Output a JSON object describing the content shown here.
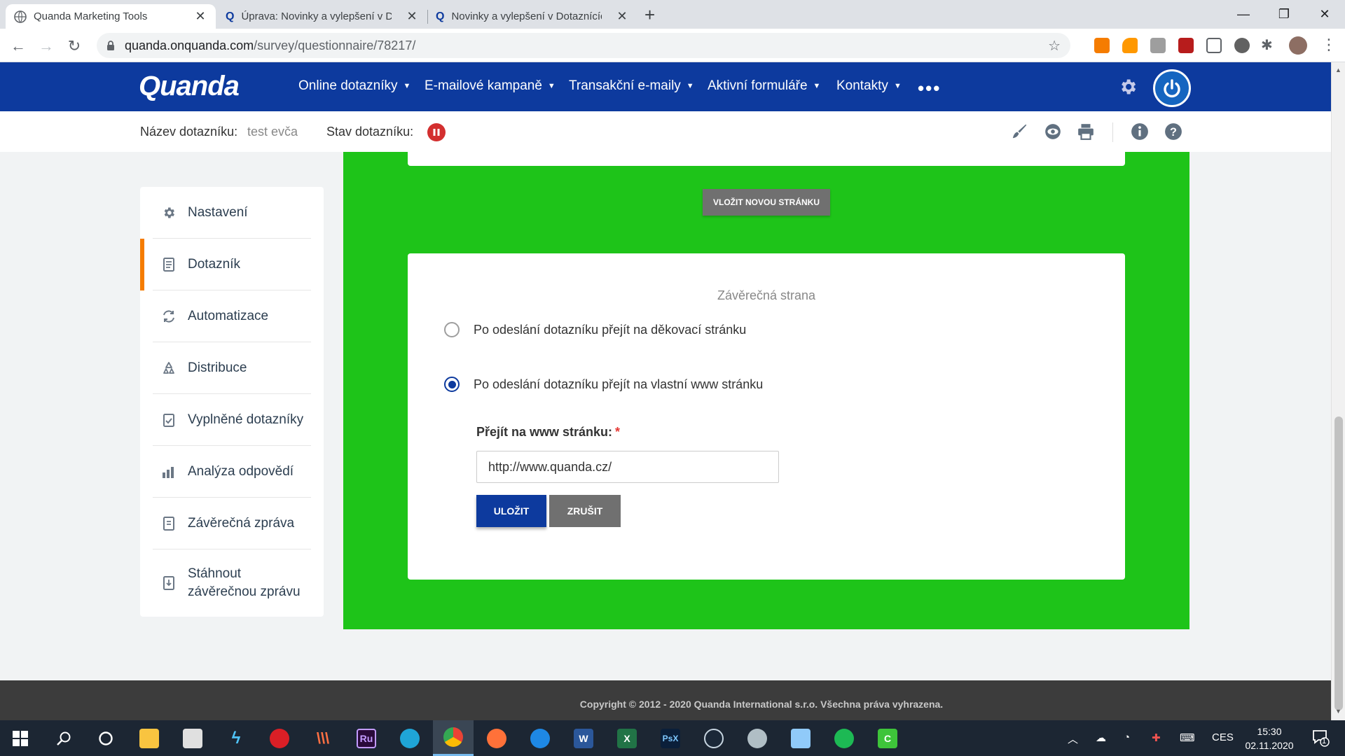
{
  "browser": {
    "tabs": [
      {
        "title": "Quanda Marketing Tools",
        "active": true
      },
      {
        "title": "Úprava: Novinky a vylepšení v Dotaznících",
        "active": false
      },
      {
        "title": "Novinky a vylepšení v Dotaznících",
        "active": false
      }
    ],
    "new_tab": "+",
    "url_host": "quanda.onquanda.com",
    "url_path": "/survey/questionnaire/78217/"
  },
  "app": {
    "logo": "Quanda",
    "menu": [
      {
        "label": "Online dotazníky"
      },
      {
        "label": "E-mailové kampaně"
      },
      {
        "label": "Transakční e-maily"
      },
      {
        "label": "Aktivní formuláře"
      },
      {
        "label": "Kontakty"
      }
    ],
    "more": "•••",
    "colors": {
      "primary": "#0d3a9e",
      "accent": "#f57c00",
      "canvas": "#1ec419",
      "status_paused": "#d32f2f"
    }
  },
  "subheader": {
    "name_label": "Název dotazníku:",
    "name_value": "test evča",
    "status_label": "Stav dotazníku:",
    "status_icon": "pause-icon"
  },
  "sidebar": {
    "items": [
      {
        "label": "Nastavení",
        "icon": "gear-icon"
      },
      {
        "label": "Dotazník",
        "icon": "document-icon",
        "active": true
      },
      {
        "label": "Automatizace",
        "icon": "refresh-icon"
      },
      {
        "label": "Distribuce",
        "icon": "recycle-icon"
      },
      {
        "label": "Vyplněné dotazníky",
        "icon": "clipboard-check-icon"
      },
      {
        "label": "Analýza odpovědí",
        "icon": "bar-chart-icon"
      },
      {
        "label": "Závěrečná zpráva",
        "icon": "report-icon"
      },
      {
        "label": "Stáhnout závěrečnou zprávu",
        "icon": "download-report-icon"
      }
    ]
  },
  "main": {
    "insert_page_button": "VLOŽIT NOVOU STRÁNKU",
    "final_page": {
      "title": "Závěrečná strana",
      "options": [
        {
          "label": "Po odeslání dotazníku přejít na děkovací stránku",
          "checked": false
        },
        {
          "label": "Po odeslání dotazníku přejít na vlastní www stránku",
          "checked": true
        }
      ],
      "url_label": "Přejít na www stránku:",
      "required_mark": "*",
      "url_value": "http://www.quanda.cz/",
      "save_label": "ULOŽIT",
      "cancel_label": "ZRUŠIT"
    }
  },
  "footer": {
    "copyright": "Copyright © 2012 - 2020 Quanda International s.r.o. Všechna práva vyhrazena."
  },
  "taskbar": {
    "lang": "CES",
    "time": "15:30",
    "date": "02.11.2020",
    "notifications": "1"
  }
}
